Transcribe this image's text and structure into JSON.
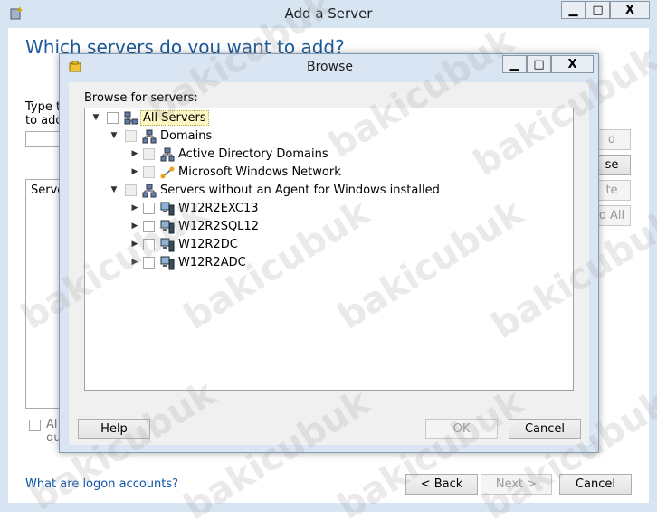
{
  "outer": {
    "title": "Add a Server",
    "heading": "Which servers do you want to add?",
    "left_label_1": "Type t",
    "left_label_2": "to add",
    "list_header": "Server",
    "right_btn_1": "d",
    "right_btn_2": "se",
    "right_btn_3": "te",
    "right_btn_4": "o All",
    "footer_check_1": "Al",
    "footer_check_2": "qu",
    "link": "What are logon accounts?",
    "back": "< Back",
    "next": "Next >",
    "cancel": "Cancel",
    "minimize": "▁",
    "maximize": "□",
    "close": "X"
  },
  "browse": {
    "title": "Browse",
    "prompt": "Browse for servers:",
    "help": "Help",
    "ok": "OK",
    "cancel": "Cancel",
    "minimize": "▁",
    "maximize": "□",
    "close": "X",
    "tree": {
      "root": "All Servers",
      "domains": "Domains",
      "ad_domains": "Active Directory Domains",
      "ms_network": "Microsoft Windows Network",
      "no_agent": "Servers without an Agent for Windows installed",
      "servers": [
        "W12R2EXC13",
        "W12R2SQL12",
        "W12R2DC",
        "W12R2ADC"
      ]
    }
  },
  "watermark": "bakicubuk",
  "colors": {
    "heading": "#1c5a9c",
    "link": "#0c54a7",
    "frame": "#d7e4f2"
  }
}
